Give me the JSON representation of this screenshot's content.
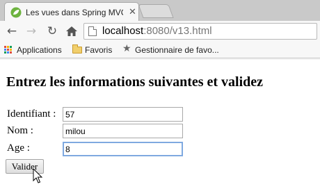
{
  "browser": {
    "tab": {
      "title": "Les vues dans Spring MVC"
    },
    "address": {
      "host": "localhost",
      "rest": ":8080/v13.html"
    },
    "bookmarks": [
      {
        "label": "Applications"
      },
      {
        "label": "Favoris"
      },
      {
        "label": "Gestionnaire de favo..."
      }
    ]
  },
  "page": {
    "heading": "Entrez les informations suivantes et validez",
    "form": {
      "id_label": "Identifiant :",
      "id_value": "57",
      "nom_label": "Nom :",
      "nom_value": "milou",
      "age_label": "Age :",
      "age_value": "8",
      "submit_label": "Valider"
    }
  },
  "icons": {
    "tab_favicon": "spring-leaf-icon",
    "back": "back-arrow-icon",
    "forward": "forward-arrow-icon",
    "reload": "reload-icon",
    "home": "home-icon",
    "page": "page-icon",
    "apps": "apps-grid-icon",
    "favoris": "folder-icon",
    "manager": "star-icon"
  },
  "colors": {
    "focus_ring": "#7fa9e0",
    "spring_green": "#6db33f"
  }
}
